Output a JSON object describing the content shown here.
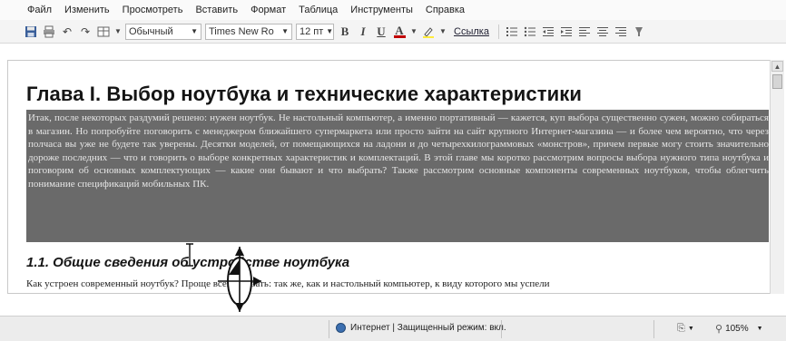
{
  "menu": [
    "Файл",
    "Изменить",
    "Просмотреть",
    "Вставить",
    "Формат",
    "Таблица",
    "Инструменты",
    "Справка"
  ],
  "toolbar": {
    "style_select": "Обычный",
    "font_select": "Times New Ro",
    "size_select": "12 пт",
    "bold_label": "B",
    "italic_label": "I",
    "underline_label": "U",
    "font_color_label": "A",
    "link_label": "Ссылка"
  },
  "document": {
    "heading": "Глава I. Выбор ноутбука и технические характеристики",
    "selected_paragraph": "Итак, после некоторых раздумий решено: нужен ноутбук. Не настольный компьютер, а именно портативный — кажется, куп выбора существенно сужен, можно собираться в магазин. Но попробуйте поговорить с менеджером ближайшего супермаркета или просто зайти на сайт крупного Интернет-магазина — и более чем вероятно, что через полчаса вы уже не будете так уверены. Десятки моделей, от помещающихся на ладони и до четырехкилограммовых «монстров», причем первые могу стоить значительно дороже последних — что и говорить о выборе конкретных характеристик и комплектаций. В этой главе мы коротко рассмотрим вопросы выбора нужного типа ноутбука и поговорим об основных комплектующих — какие они бывают и что выбрать? Также рассмотрим основные компоненты современных ноутбуков, чтобы облегчить понимание спецификаций мобильных ПК.",
    "subheading": "1.1. Общие сведения об устройстве ноутбука",
    "body_line": "Как устроен современный ноутбук? Проще всего сказать: так же, как и настольный компьютер, к виду которого мы успели"
  },
  "status": {
    "zone_text": "Интернет | Защищенный режим: вкл.",
    "zoom_text": "105%"
  }
}
